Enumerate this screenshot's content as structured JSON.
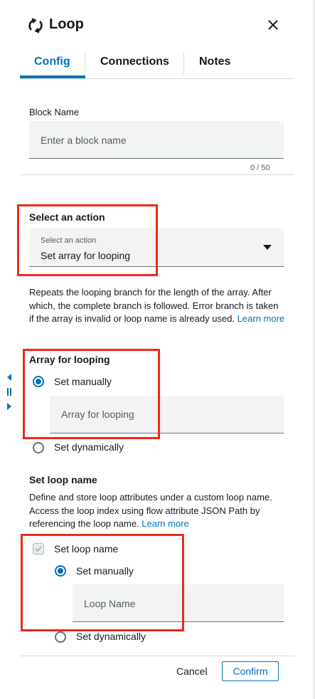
{
  "header": {
    "title": "Loop",
    "icon": "loop-icon",
    "close_icon": "close-icon"
  },
  "tabs": [
    {
      "label": "Config",
      "active": true
    },
    {
      "label": "Connections",
      "active": false
    },
    {
      "label": "Notes",
      "active": false
    }
  ],
  "block_name": {
    "label": "Block Name",
    "placeholder": "Enter a block name",
    "value": "",
    "counter": "0 / 50"
  },
  "action": {
    "label": "Select an action",
    "select_placeholder": "Select an action",
    "select_value": "Set array for looping",
    "description": "Repeats the looping branch for the length of the array. After which, the complete branch is followed. Error branch is taken if the array is invalid or loop name is already used.",
    "learn_more": "Learn more"
  },
  "array": {
    "label": "Array for looping",
    "option_manual": "Set manually",
    "option_dynamic": "Set dynamically",
    "selected": "Set manually",
    "input_placeholder": "Array for looping"
  },
  "loop_name": {
    "label": "Set loop name",
    "description": "Define and store loop attributes under a custom loop name. Access the loop index using flow attribute JSON Path by referencing the loop name.",
    "learn_more": "Learn more",
    "checkbox_label": "Set loop name",
    "checkbox_checked": true,
    "option_manual": "Set manually",
    "option_dynamic": "Set dynamically",
    "selected": "Set manually",
    "input_placeholder": "Loop Name"
  },
  "footer": {
    "cancel_label": "Cancel",
    "confirm_label": "Confirm"
  },
  "colors": {
    "accent": "#0073bb",
    "highlight": "#ee2a1a",
    "input_bg": "#f2f3f3"
  }
}
